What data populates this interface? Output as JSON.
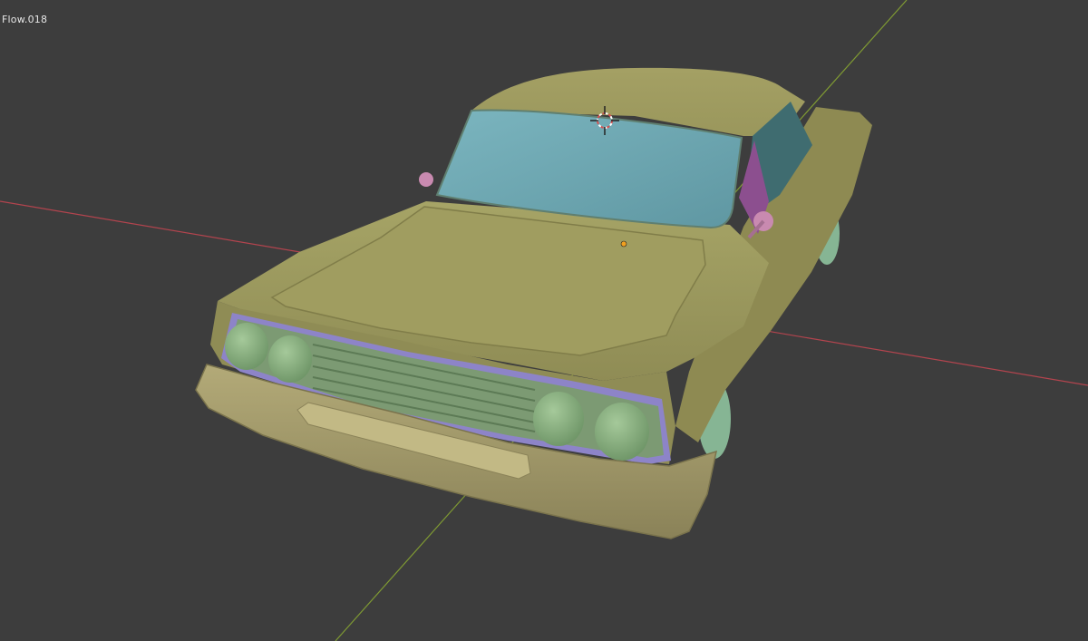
{
  "viewport": {
    "object_name": "Flow.018"
  },
  "colors": {
    "background": "#3d3d3d",
    "x_axis": "#b3444e",
    "y_axis": "#7f9a33",
    "body_paint": "#9f9c5f",
    "windshield": "#6fa9b3",
    "grille_trim": "#8d84c8",
    "headlights": "#8db582",
    "mirrors": "#c98ab0"
  },
  "icons": {
    "cursor": "3d-cursor-icon",
    "origin": "object-origin-icon"
  }
}
